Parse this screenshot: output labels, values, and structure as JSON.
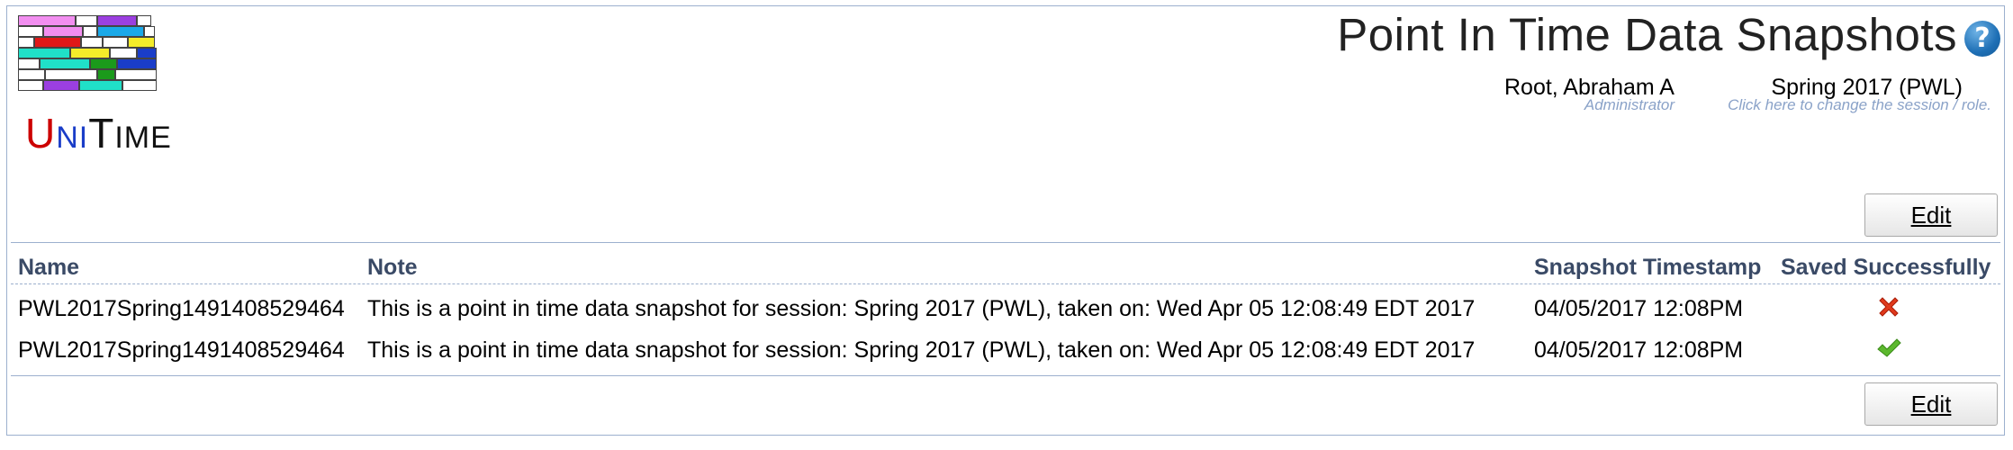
{
  "header": {
    "title": "Point In Time Data Snapshots",
    "help_icon": "help-icon",
    "user": {
      "name": "Root, Abraham A",
      "role": "Administrator"
    },
    "session": {
      "name": "Spring 2017 (PWL)",
      "hint": "Click here to change the session / role."
    }
  },
  "logo": {
    "text_u": "U",
    "text_ni": "NI",
    "text_t": "T",
    "text_ime": "IME"
  },
  "toolbar": {
    "edit_label": "Edit"
  },
  "table": {
    "columns": [
      "Name",
      "Note",
      "Snapshot Timestamp",
      "Saved Successfully"
    ],
    "rows": [
      {
        "name": "PWL2017Spring1491408529464",
        "note": "This is a point in time data snapshot for session: Spring 2017 (PWL), taken on: Wed Apr 05 12:08:49 EDT 2017",
        "timestamp": "04/05/2017 12:08PM",
        "saved_icon": "red-x-icon"
      },
      {
        "name": "PWL2017Spring1491408529464",
        "note": "This is a point in time data snapshot for session: Spring 2017 (PWL), taken on: Wed Apr 05 12:08:49 EDT 2017",
        "timestamp": "04/05/2017 12:08PM",
        "saved_icon": "green-check-icon"
      }
    ]
  },
  "colors": {
    "accent": "#9cb0ce",
    "header_text": "#3a4a66",
    "hint": "#8aa2c8"
  }
}
